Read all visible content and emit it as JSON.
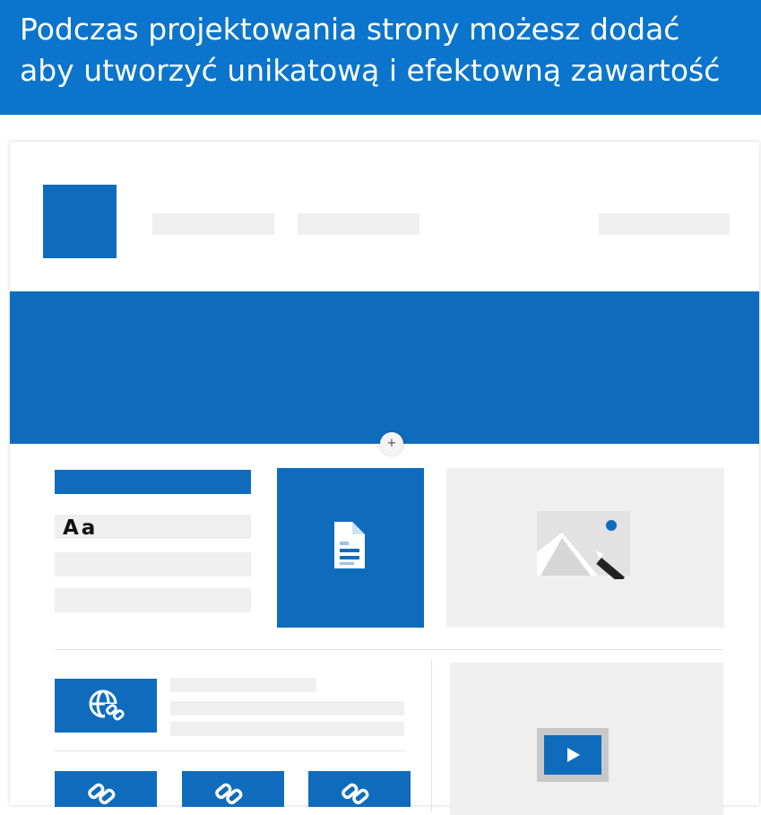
{
  "banner": {
    "line1": "Podczas projektowania strony możesz dodać",
    "line2": "aby utworzyć unikatową i efektowną zawartość"
  },
  "layout_preview": {
    "add_section_label": "+",
    "text_webpart_sample": "Aa",
    "icons": {
      "document": "document-icon",
      "image": "image-icon",
      "link": "globe-link-icon",
      "quick_links": "link-icon",
      "video": "play-icon"
    }
  },
  "colors": {
    "banner_blue": "#0b75cd",
    "tile_blue": "#0f6cbd",
    "placeholder_gray": "#efefef",
    "white": "#ffffff"
  }
}
